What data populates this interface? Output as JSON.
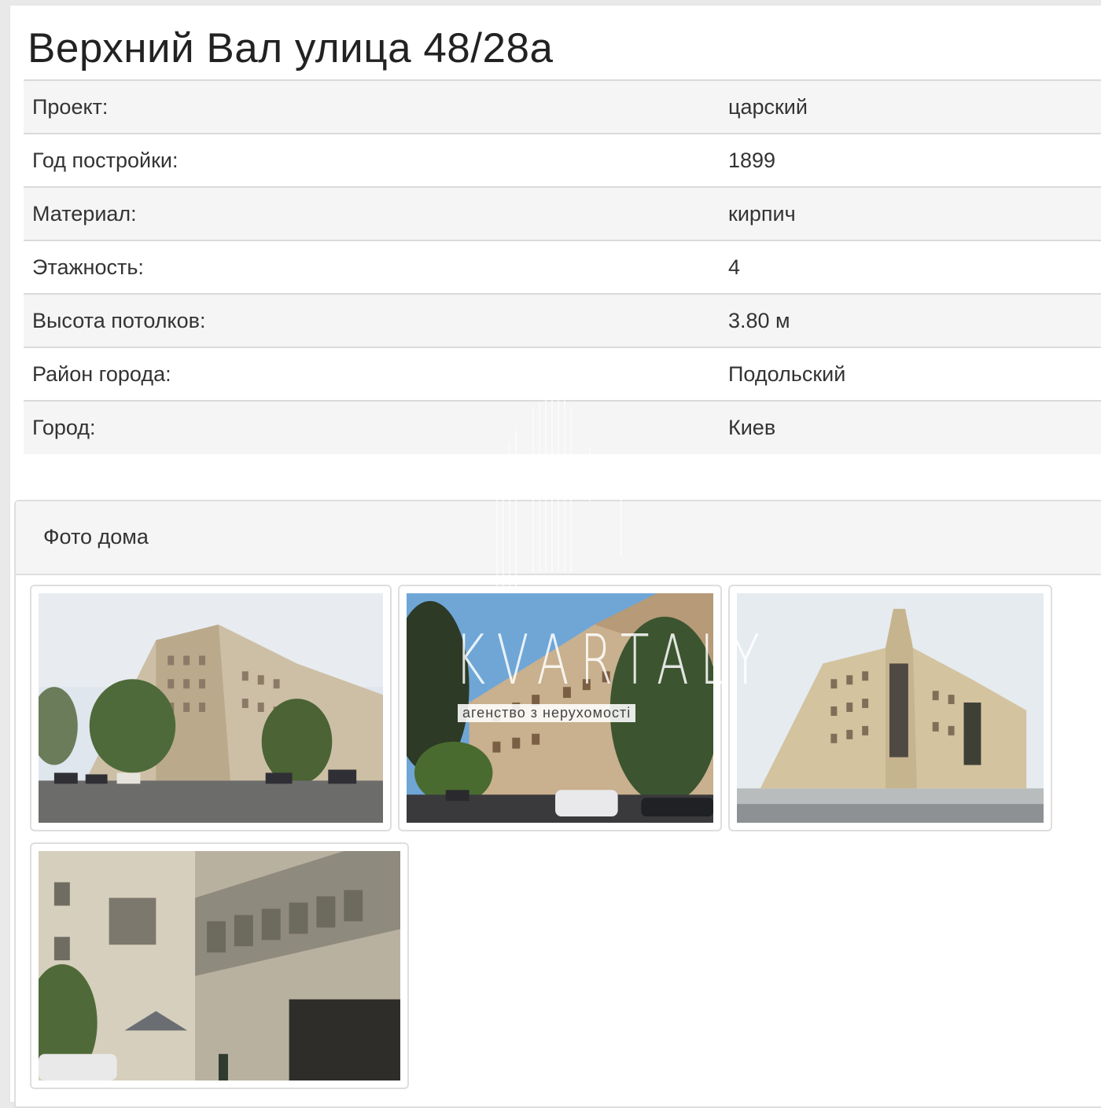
{
  "title": "Верхний Вал улица 48/28а",
  "properties": [
    {
      "label": "Проект:",
      "value": "царский"
    },
    {
      "label": "Год постройки:",
      "value": "1899"
    },
    {
      "label": "Материал:",
      "value": "кирпич"
    },
    {
      "label": "Этажность:",
      "value": "4"
    },
    {
      "label": "Высота потолков:",
      "value": "3.80 м"
    },
    {
      "label": "Район города:",
      "value": "Подольский"
    },
    {
      "label": "Город:",
      "value": "Киев"
    }
  ],
  "photos": {
    "heading": "Фото дома",
    "items": [
      {
        "name": "photo-1",
        "subject": "corner-building-street-view"
      },
      {
        "name": "photo-2",
        "subject": "building-facade-trees"
      },
      {
        "name": "photo-3",
        "subject": "corner-building-with-tower"
      },
      {
        "name": "photo-4",
        "subject": "courtyard-balconies"
      }
    ]
  },
  "watermark": {
    "brand": "KVARTALY",
    "tagline": "агенство з нерухомості"
  },
  "colors": {
    "row_alt": "#f5f5f5",
    "border": "#dedede",
    "text": "#333333"
  }
}
